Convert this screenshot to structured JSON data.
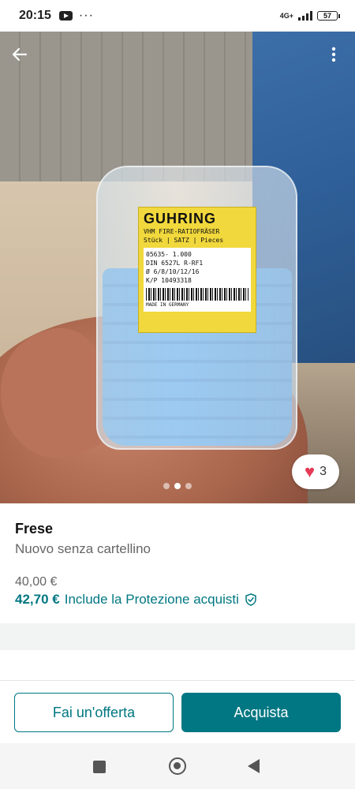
{
  "status_bar": {
    "time": "20:15",
    "more": "···",
    "network": "4G+",
    "battery": "57"
  },
  "photo": {
    "label_brand": "GUHRING",
    "label_lines": [
      "VHM FIRE-RATIOFRÄSER",
      "Stück | SATZ | Pieces",
      "05635- 1.000",
      "DIN 6527L R-RF1",
      "Ø 6/8/10/12/16",
      "K/P 10493318",
      "MADE IN GERMANY"
    ],
    "carousel_total": 3,
    "carousel_active": 2,
    "favourites": "3"
  },
  "item": {
    "title": "Frese",
    "condition": "Nuovo senza cartellino",
    "price": "40,00 €",
    "price_with_protection": "42,70 €",
    "protection_text": "Include la Protezione acquisti"
  },
  "actions": {
    "offer_label": "Fai un'offerta",
    "buy_label": "Acquista"
  },
  "colors": {
    "accent": "#007782",
    "heart": "#e53955"
  },
  "icons": {
    "back": "arrow-left-icon",
    "menu": "more-vertical-icon",
    "favourite": "heart-icon",
    "protection": "shield-check-icon"
  }
}
